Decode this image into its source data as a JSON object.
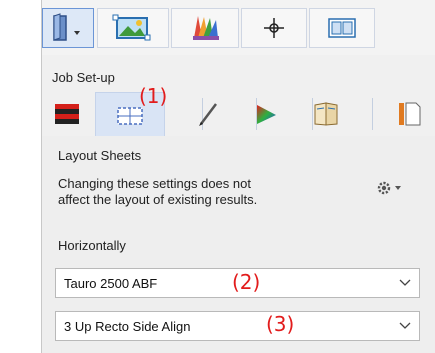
{
  "toolbar": {
    "buttons": [
      {
        "icon": "book-dropdown-icon",
        "selected": true
      },
      {
        "icon": "image-frame-icon",
        "selected": false
      },
      {
        "icon": "color-swatch-icon",
        "selected": false
      },
      {
        "icon": "crosshair-icon",
        "selected": false
      },
      {
        "icon": "layout-panel-icon",
        "selected": false
      }
    ]
  },
  "section": {
    "label": "Job Set-up"
  },
  "tabs": [
    {
      "icon": "paper-stack-icon",
      "selected": false
    },
    {
      "icon": "layout-sheet-icon",
      "selected": true
    },
    {
      "icon": "pen-icon",
      "selected": false
    },
    {
      "icon": "color-triangle-icon",
      "selected": false
    },
    {
      "icon": "book-pages-icon",
      "selected": false
    },
    {
      "icon": "document-icon",
      "selected": false
    }
  ],
  "annotations": {
    "one": "(1)",
    "two": "(2)",
    "three": "(3)"
  },
  "panel": {
    "title": "Layout Sheets",
    "description_line1": "Changing these settings does not",
    "description_line2": "affect the layout of existing results.",
    "orientation_label": "Horizontally",
    "press_select": {
      "value": "Tauro 2500 ABF"
    },
    "layout_select": {
      "value": "3 Up Recto Side Align"
    }
  },
  "colors": {
    "accent": "#6b95d6",
    "callout": "#e21c1c",
    "selected_tab": "#d9e4f5"
  }
}
